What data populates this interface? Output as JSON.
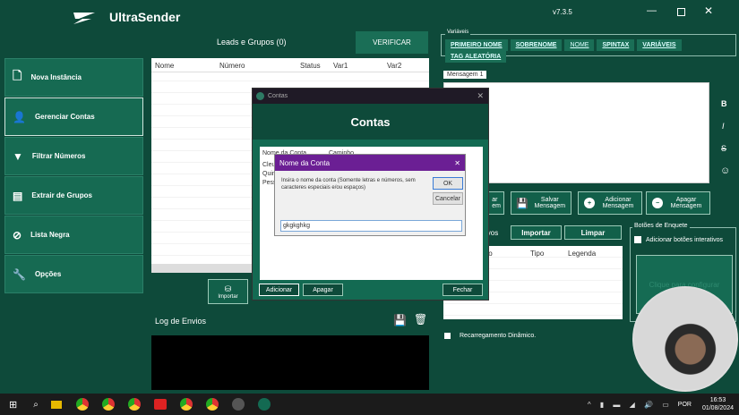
{
  "app": {
    "name": "UltraSender",
    "version": "v7.3.5"
  },
  "leads": {
    "title": "Leads e Grupos (0)",
    "verify": "VERIFICAR",
    "columns": [
      "Nome",
      "Número",
      "Status",
      "Var1",
      "Var2"
    ],
    "import": "Importar"
  },
  "sidebar": {
    "items": [
      {
        "label": "Nova Instância"
      },
      {
        "label": "Gerenciar Contas"
      },
      {
        "label": "Filtrar Números"
      },
      {
        "label": "Extrair de Grupos"
      },
      {
        "label": "Lista Negra"
      },
      {
        "label": "Opções"
      }
    ]
  },
  "log": {
    "title": "Log de Envios"
  },
  "variables": {
    "legend": "Variáveis",
    "buttons": [
      "PRIMEIRO NOME",
      "SOBRENOME",
      "NOME",
      "SPINTAX",
      "VARIÁVEIS",
      "TAG ALEATÓRIA"
    ]
  },
  "message": {
    "tab": "Mensagem 1",
    "format": [
      "B",
      "I",
      "S",
      "☺"
    ],
    "partial_button": "ar\nem",
    "save": "Salvar Mensagem",
    "add": "Adicionar Mensagem",
    "delete": "Apagar Mensagem"
  },
  "files": {
    "label": "ivos",
    "import": "Importar",
    "clear": "Limpar",
    "columns": [
      "to",
      "Tipo",
      "Legenda"
    ]
  },
  "poll": {
    "legend": "Botões de Enquete",
    "checkbox": "Adicionar botões interativos",
    "configure": "Clique para configurar"
  },
  "dynamic_reload": "Recarregamento Dinâmico.",
  "contas": {
    "window_title": "Contas",
    "header": "Contas",
    "columns": [
      "Nome da Conta",
      "Caminho"
    ],
    "items": [
      "Cleu",
      "Quin",
      "Pess"
    ],
    "add": "Adicionar",
    "delete": "Apagar",
    "close": "Fechar"
  },
  "prompt": {
    "title": "Nome da Conta",
    "message": "Insira o nome da conta (Somente letras e números, sem caracteres especiais e/ou espaços)",
    "ok": "OK",
    "cancel": "Cancelar",
    "value": "gkgkghkg"
  },
  "taskbar": {
    "lang": "POR",
    "time": "16:53",
    "date": "01/08/2024"
  }
}
